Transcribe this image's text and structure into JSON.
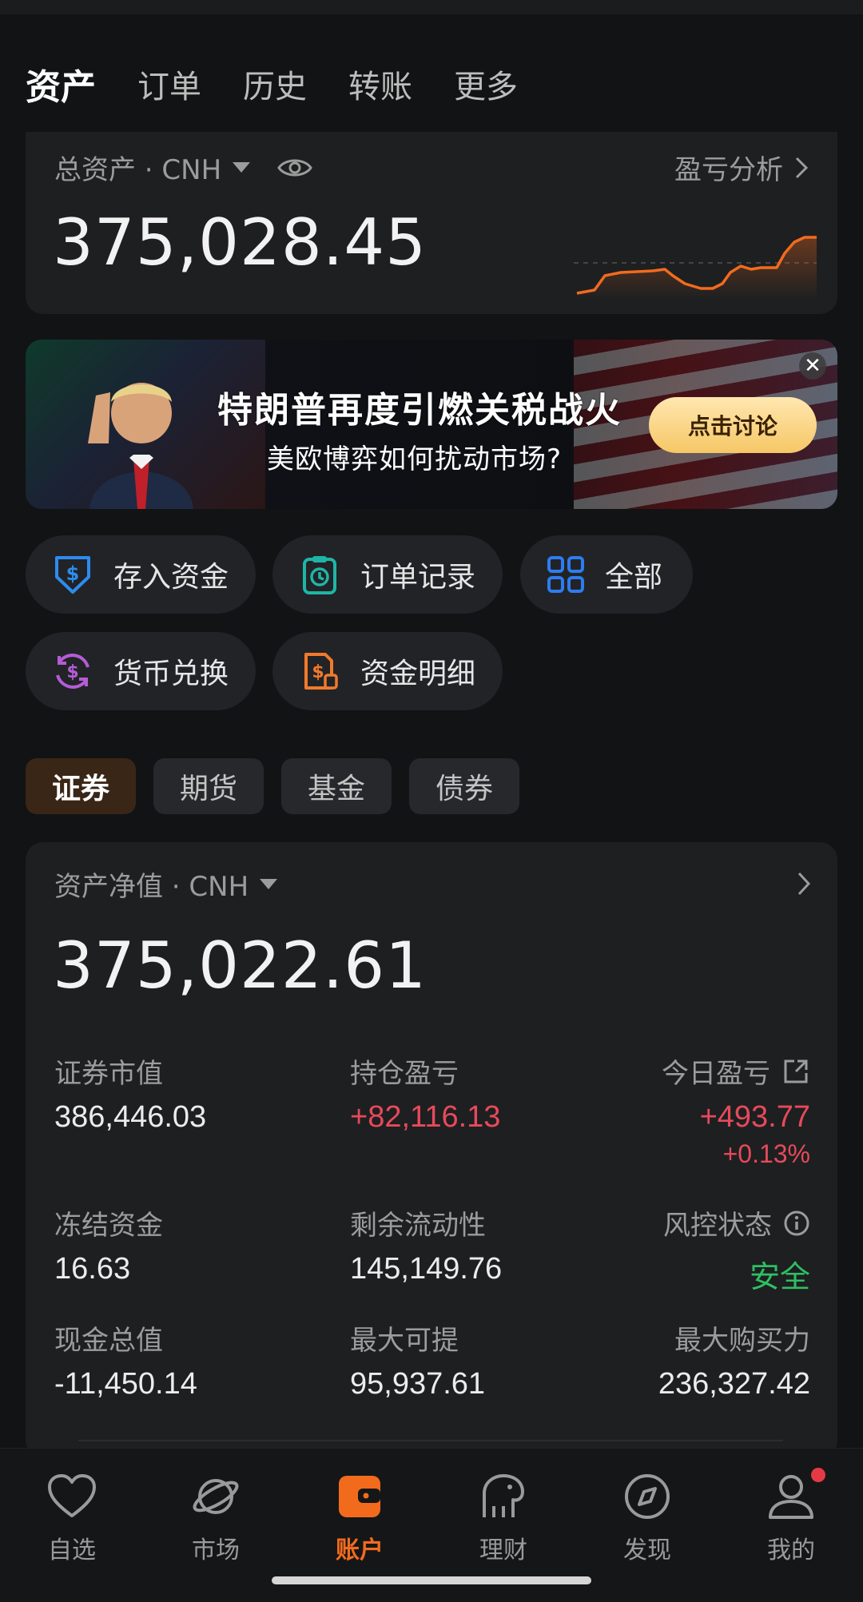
{
  "top_tabs": [
    "资产",
    "订单",
    "历史",
    "转账",
    "更多"
  ],
  "total_card": {
    "label": "总资产 · CNH",
    "pnl_link": "盈亏分析",
    "value": "375,028.45",
    "accent_color": "#f26b1d"
  },
  "banner": {
    "title": "特朗普再度引燃关税战火",
    "subtitle": "美欧博弈如何扰动市场?",
    "button": "点击讨论",
    "close": "✕"
  },
  "quick_actions": [
    {
      "label": "存入资金",
      "icon": "deposit-shield-icon",
      "color": "#2d8cf0"
    },
    {
      "label": "订单记录",
      "icon": "clipboard-clock-icon",
      "color": "#1fb5a6"
    },
    {
      "label": "全部",
      "icon": "grid-icon",
      "color": "#2d7cf0"
    },
    {
      "label": "货币兑换",
      "icon": "currency-exchange-icon",
      "color": "#b45cd6"
    },
    {
      "label": "资金明细",
      "icon": "fund-detail-icon",
      "color": "#f07a2d"
    }
  ],
  "categories": [
    "证券",
    "期货",
    "基金",
    "债券"
  ],
  "net_card": {
    "label": "资产净值 · CNH",
    "value": "375,022.61",
    "metrics": {
      "market_value": {
        "label": "证券市值",
        "value": "386,446.03"
      },
      "position_pnl": {
        "label": "持仓盈亏",
        "value": "+82,116.13"
      },
      "today_pnl": {
        "label": "今日盈亏",
        "value": "+493.77",
        "percent": "+0.13%"
      },
      "frozen": {
        "label": "冻结资金",
        "value": "16.63"
      },
      "liquidity": {
        "label": "剩余流动性",
        "value": "145,149.76"
      },
      "risk": {
        "label": "风控状态",
        "value": "安全"
      },
      "cash": {
        "label": "现金总值",
        "value": "-11,450.14"
      },
      "max_withdraw": {
        "label": "最大可提",
        "value": "95,937.61"
      },
      "buying_power": {
        "label": "最大购买力",
        "value": "236,327.42"
      }
    },
    "up_color": "#e64a5a",
    "safe_color": "#2fbf63"
  },
  "bottom_nav": [
    {
      "label": "自选",
      "icon": "heart-icon"
    },
    {
      "label": "市场",
      "icon": "planet-icon"
    },
    {
      "label": "账户",
      "icon": "wallet-icon",
      "active": true
    },
    {
      "label": "理财",
      "icon": "elephant-icon"
    },
    {
      "label": "发现",
      "icon": "compass-icon"
    },
    {
      "label": "我的",
      "icon": "user-icon",
      "badge": true
    }
  ]
}
